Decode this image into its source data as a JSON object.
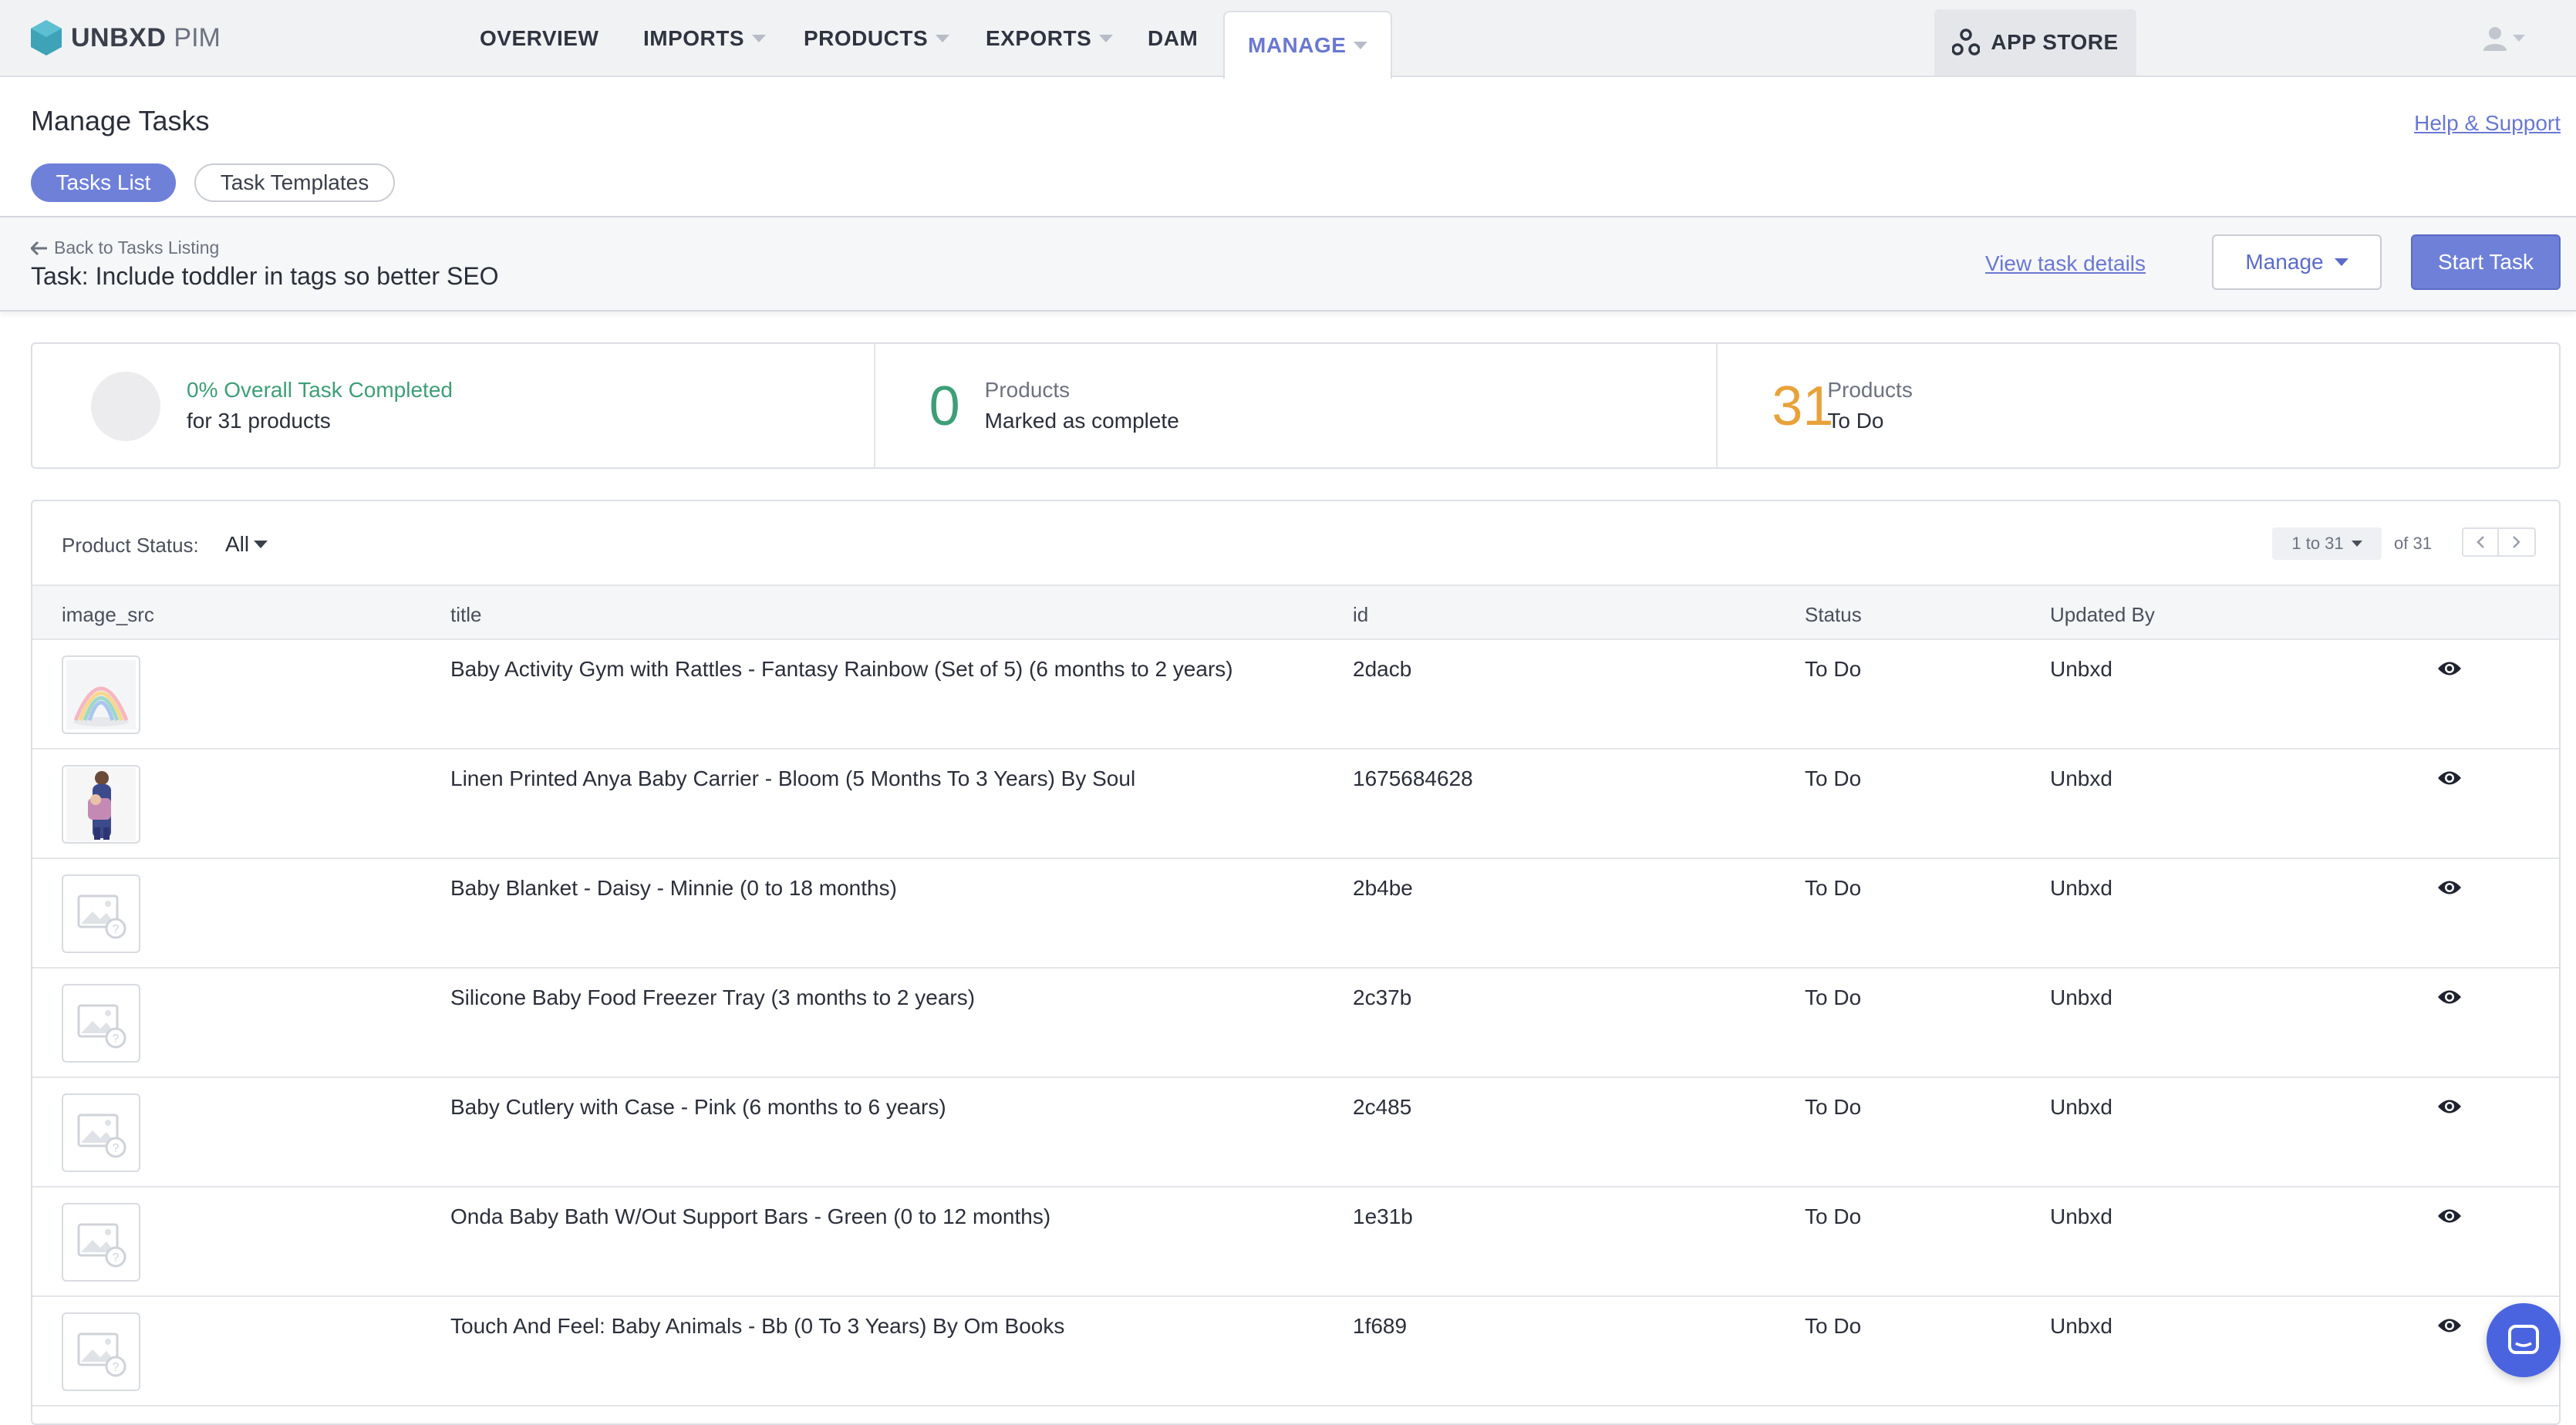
{
  "brand": {
    "name": "UNBXD",
    "product": "PIM",
    "accent": "#6f80d9",
    "logo_color": "#3fa3b8"
  },
  "nav": {
    "items": [
      {
        "label": "OVERVIEW",
        "has_caret": false
      },
      {
        "label": "IMPORTS",
        "has_caret": true
      },
      {
        "label": "PRODUCTS",
        "has_caret": true
      },
      {
        "label": "EXPORTS",
        "has_caret": true
      },
      {
        "label": "DAM",
        "has_caret": false
      },
      {
        "label": "MANAGE",
        "has_caret": true,
        "active": true
      }
    ],
    "app_store": "APP STORE",
    "user_icon": "user-icon"
  },
  "page": {
    "title": "Manage Tasks",
    "help_link": "Help & Support",
    "tabs": [
      {
        "label": "Tasks List",
        "active": true
      },
      {
        "label": "Task Templates",
        "active": false
      }
    ]
  },
  "task": {
    "back_label": "Back to Tasks Listing",
    "name": "Task: Include toddler in tags so better SEO",
    "view_details": "View task details",
    "manage_label": "Manage",
    "start_label": "Start Task"
  },
  "stats": {
    "overall": {
      "line1": "0% Overall Task Completed",
      "line2": "for 31 products",
      "progress": 0
    },
    "complete": {
      "value": "0",
      "line1": "Products",
      "line2": "Marked as complete",
      "color": "#3e9e78"
    },
    "todo": {
      "value": "31",
      "line1": "Products",
      "line2": "To Do",
      "color": "#e8a23b"
    }
  },
  "table": {
    "filter_label": "Product Status:",
    "filter_value": "All",
    "pager_range": "1 to 31",
    "pager_total": "of 31",
    "columns": [
      "image_src",
      "title",
      "id",
      "Status",
      "Updated By"
    ],
    "rows": [
      {
        "image": "rainbow-gym",
        "title": "Baby Activity Gym with Rattles - Fantasy Rainbow (Set of 5) (6 months to 2 years)",
        "id": "2dacb",
        "status": "To Do",
        "updated_by": "Unbxd"
      },
      {
        "image": "baby-carrier",
        "title": "Linen Printed Anya Baby Carrier - Bloom (5 Months To 3 Years) By Soul",
        "id": "1675684628",
        "status": "To Do",
        "updated_by": "Unbxd"
      },
      {
        "image": "placeholder",
        "title": "Baby Blanket - Daisy - Minnie (0 to 18 months)",
        "id": "2b4be",
        "status": "To Do",
        "updated_by": "Unbxd"
      },
      {
        "image": "placeholder",
        "title": "Silicone Baby Food Freezer Tray (3 months to 2 years)",
        "id": "2c37b",
        "status": "To Do",
        "updated_by": "Unbxd"
      },
      {
        "image": "placeholder",
        "title": "Baby Cutlery with Case - Pink (6 months to 6 years)",
        "id": "2c485",
        "status": "To Do",
        "updated_by": "Unbxd"
      },
      {
        "image": "placeholder",
        "title": "Onda Baby Bath W/Out Support Bars - Green (0 to 12 months)",
        "id": "1e31b",
        "status": "To Do",
        "updated_by": "Unbxd"
      },
      {
        "image": "placeholder",
        "title": "Touch And Feel: Baby Animals - Bb (0 To 3 Years) By Om Books",
        "id": "1f689",
        "status": "To Do",
        "updated_by": "Unbxd"
      }
    ]
  }
}
